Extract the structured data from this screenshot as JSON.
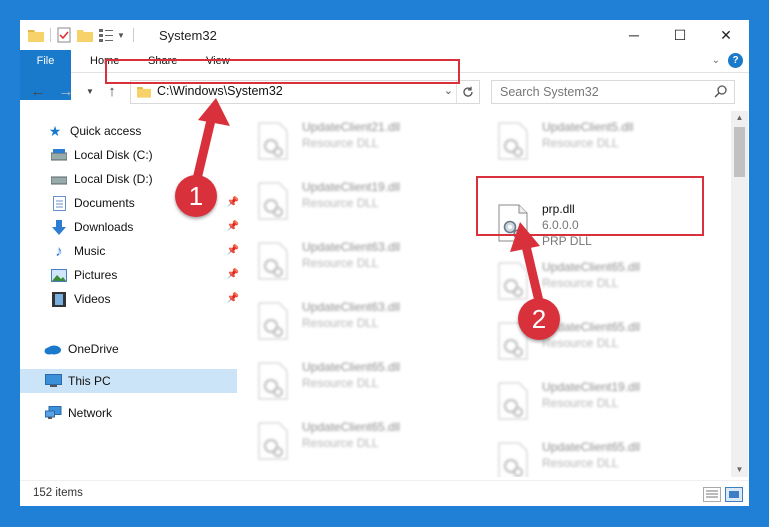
{
  "window": {
    "title": "System32",
    "tabs": {
      "file": "File",
      "home": "Home",
      "share": "Share",
      "view": "View"
    },
    "help": "?"
  },
  "address": {
    "path": "C:\\Windows\\System32",
    "search_placeholder": "Search System32"
  },
  "nav": {
    "quick_access": "Quick access",
    "items": [
      {
        "label": "Local Disk (C:)",
        "icon": "drive-icon"
      },
      {
        "label": "Local Disk (D:)",
        "icon": "drive-icon"
      },
      {
        "label": "Documents",
        "icon": "documents-icon"
      },
      {
        "label": "Downloads",
        "icon": "downloads-icon"
      },
      {
        "label": "Music",
        "icon": "music-icon"
      },
      {
        "label": "Pictures",
        "icon": "pictures-icon"
      },
      {
        "label": "Videos",
        "icon": "videos-icon"
      }
    ],
    "onedrive": "OneDrive",
    "this_pc": "This PC",
    "network": "Network"
  },
  "files": {
    "left": [
      {
        "name": "UpdateClient21.dll",
        "type": "Resource DLL"
      },
      {
        "name": "UpdateClient19.dll",
        "type": "Resource DLL"
      },
      {
        "name": "UpdateClient63.dll",
        "type": "Resource DLL"
      },
      {
        "name": "UpdateClient63.dll",
        "type": "Resource DLL"
      },
      {
        "name": "UpdateClient65.dll",
        "type": "Resource DLL"
      },
      {
        "name": "UpdateClient65.dll",
        "type": "Resource DLL"
      }
    ],
    "right": [
      {
        "name": "UpdateClient5.dll",
        "type": "Resource DLL"
      },
      {
        "name": "UpdateClient65.dll",
        "type": "Resource DLL"
      },
      {
        "name": "UpdateClient65.dll",
        "type": "Resource DLL"
      },
      {
        "name": "UpdateClient19.dll",
        "type": "Resource DLL"
      },
      {
        "name": "UpdateClient65.dll",
        "type": "Resource DLL"
      }
    ],
    "highlight": {
      "name": "prp.dll",
      "version": "6.0.0.0",
      "desc": "PRP DLL"
    }
  },
  "status": {
    "count": "152 items"
  },
  "callouts": {
    "one": "1",
    "two": "2"
  },
  "colors": {
    "accent": "#1979ca",
    "callout": "#d9313b",
    "selected": "#cce4f7"
  }
}
